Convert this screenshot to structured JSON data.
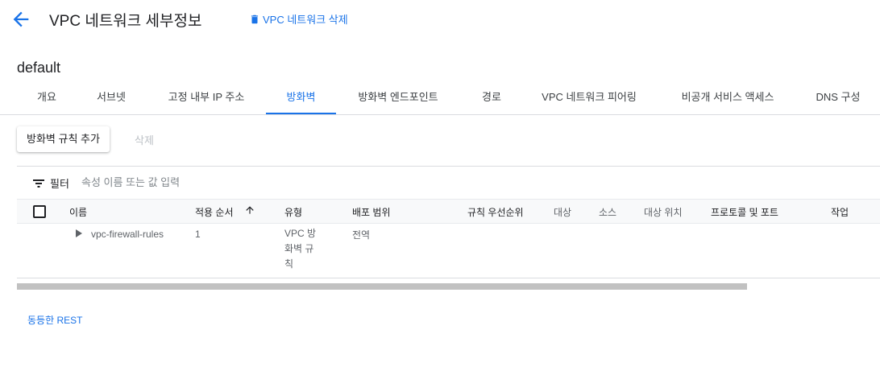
{
  "header": {
    "title": "VPC 네트워크 세부정보",
    "delete_network_label": "VPC 네트워크 삭제",
    "back_icon": "arrow-left-icon",
    "delete_icon": "trash-icon"
  },
  "network_name": "default",
  "tabs": [
    {
      "label": "개요",
      "active": false
    },
    {
      "label": "서브넷",
      "active": false
    },
    {
      "label": "고정 내부 IP 주소",
      "active": false
    },
    {
      "label": "방화벽",
      "active": true
    },
    {
      "label": "방화벽 엔드포인트",
      "active": false
    },
    {
      "label": "경로",
      "active": false
    },
    {
      "label": "VPC 네트워크 피어링",
      "active": false
    },
    {
      "label": "비공개 서비스 액세스",
      "active": false
    },
    {
      "label": "DNS 구성",
      "active": false
    }
  ],
  "actions": {
    "add_rule_label": "방화벽 규칙 추가",
    "delete_label": "삭제"
  },
  "filter": {
    "label": "필터",
    "placeholder": "속성 이름 또는 값 입력",
    "icon": "filter-icon"
  },
  "table": {
    "columns": {
      "name": "이름",
      "order": "적용 순서",
      "type": "유형",
      "scope": "배포 범위",
      "priority": "규칙 우선순위",
      "target": "대상",
      "source": "소스",
      "target_location": "대상 위치",
      "protocol_port": "프로토콜 및 포트",
      "action": "작업"
    },
    "sort_icon": "arrow-up-icon",
    "rows": [
      {
        "name": "vpc-firewall-rules",
        "order": "1",
        "type": "VPC 방화벽 규칙",
        "type_lines": [
          "VPC 방",
          "화벽 규",
          "칙"
        ],
        "scope": "전역"
      }
    ]
  },
  "footer": {
    "rest_link": "동등한 REST"
  },
  "colors": {
    "accent": "#1a73e8",
    "text": "#202124",
    "muted": "#5f6368",
    "border": "#dadce0"
  }
}
